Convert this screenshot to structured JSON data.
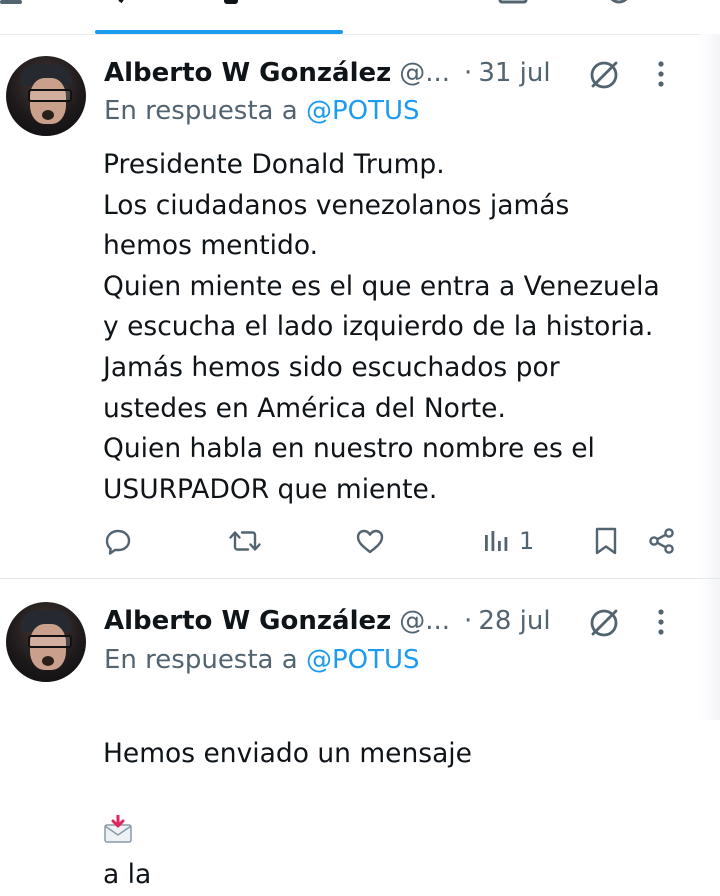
{
  "colors": {
    "accent": "#1d9bf0",
    "text_primary": "#0f1419",
    "text_secondary": "#536471",
    "divider": "#e6e9eb"
  },
  "icons": {
    "reply": "speech-bubble-icon",
    "retweet": "retweet-arrows-icon",
    "like": "heart-icon",
    "views": "bar-chart-icon",
    "bookmark": "bookmark-icon",
    "share": "share-nodes-icon",
    "grok": "grok-slash-circle-icon",
    "more": "vertical-ellipsis-icon"
  },
  "tweets": [
    {
      "author_name": "Alberto W González",
      "handle": "@...",
      "separator": "·",
      "date": "31 jul",
      "reply_prefix": "En respuesta a",
      "reply_to": "@POTUS",
      "text": "Presidente Donald Trump.\nLos ciudadanos venezolanos jamás\nhemos mentido.\nQuien miente es el que entra a Venezuela\ny escucha el lado izquierdo de la historia.\nJamás hemos sido escuchados por\nustedes en América del Norte.\nQuien habla en nuestro nombre es el\nUSURPADOR que miente.",
      "views": "1"
    },
    {
      "author_name": "Alberto W González",
      "handle": "@...",
      "separator": "·",
      "date": "28 jul",
      "reply_prefix": "En respuesta a",
      "reply_to": "@POTUS",
      "text_before_emoji": "Hemos enviado un mensaje",
      "text_after_emoji": "a la"
    }
  ]
}
